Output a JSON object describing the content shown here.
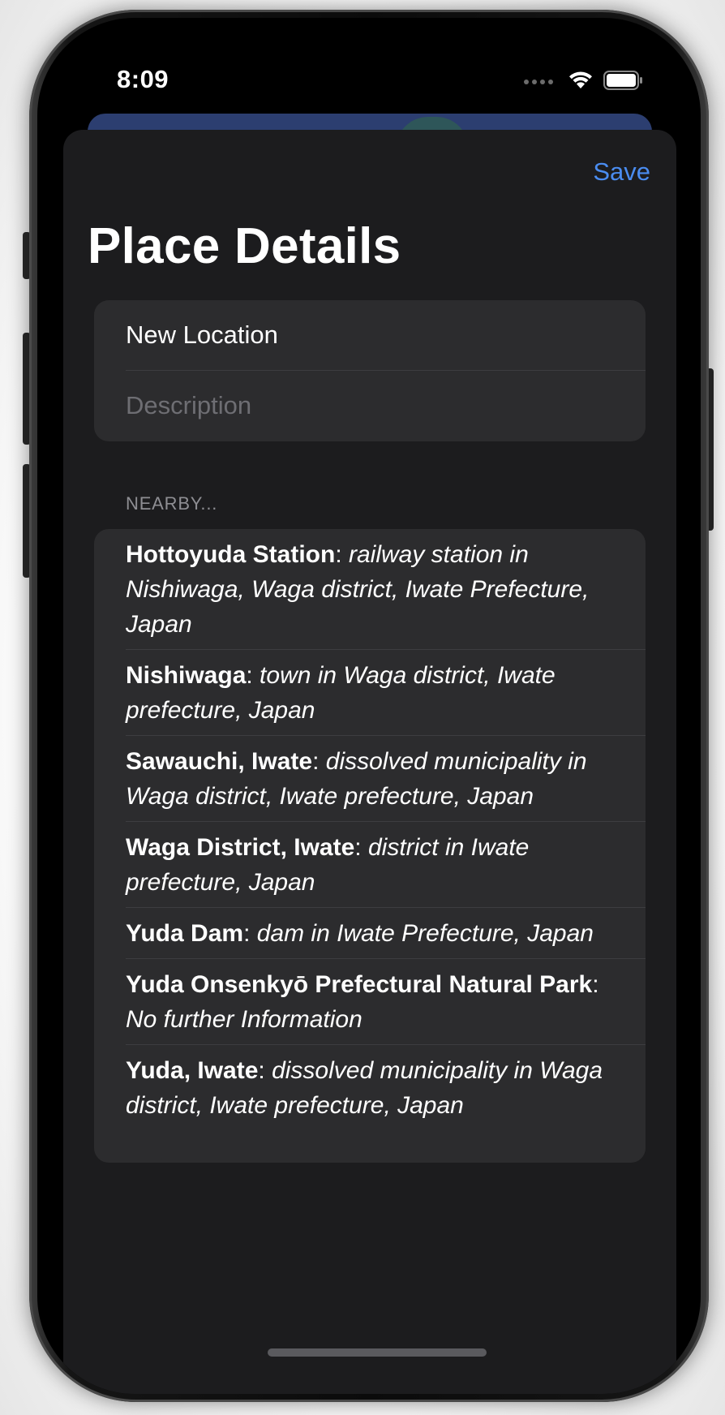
{
  "status_bar": {
    "time": "8:09",
    "icons": [
      "signal-dots-icon",
      "wifi-icon",
      "battery-icon"
    ]
  },
  "nav": {
    "save_label": "Save",
    "title": "Place Details"
  },
  "form": {
    "name_value": "New Location",
    "description_placeholder": "Description"
  },
  "nearby": {
    "header": "NEARBY...",
    "items": [
      {
        "name": "Hottoyuda Station",
        "separator": ": ",
        "description": "railway station in Nishiwaga, Waga district, Iwate Prefecture, Japan"
      },
      {
        "name": "Nishiwaga",
        "separator": ": ",
        "description": "town in Waga district, Iwate prefecture, Japan"
      },
      {
        "name": "Sawauchi, Iwate",
        "separator": ": ",
        "description": "dissolved municipality in Waga district, Iwate prefecture, Japan"
      },
      {
        "name": "Waga District, Iwate",
        "separator": ": ",
        "description": "district in Iwate prefecture, Japan"
      },
      {
        "name": "Yuda Dam",
        "separator": ": ",
        "description": "dam in Iwate Prefecture, Japan"
      },
      {
        "name": "Yuda Onsenkyō Prefectural Natural Park",
        "separator": ": ",
        "description": "No further Information"
      },
      {
        "name": "Yuda, Iwate",
        "separator": ": ",
        "description": "dissolved municipality in Waga district, Iwate prefecture, Japan"
      }
    ]
  },
  "colors": {
    "accent": "#4a8cf0",
    "sheet_background": "#1c1c1e",
    "group_background": "#2c2c2e",
    "secondary_text": "#8e8e93"
  }
}
